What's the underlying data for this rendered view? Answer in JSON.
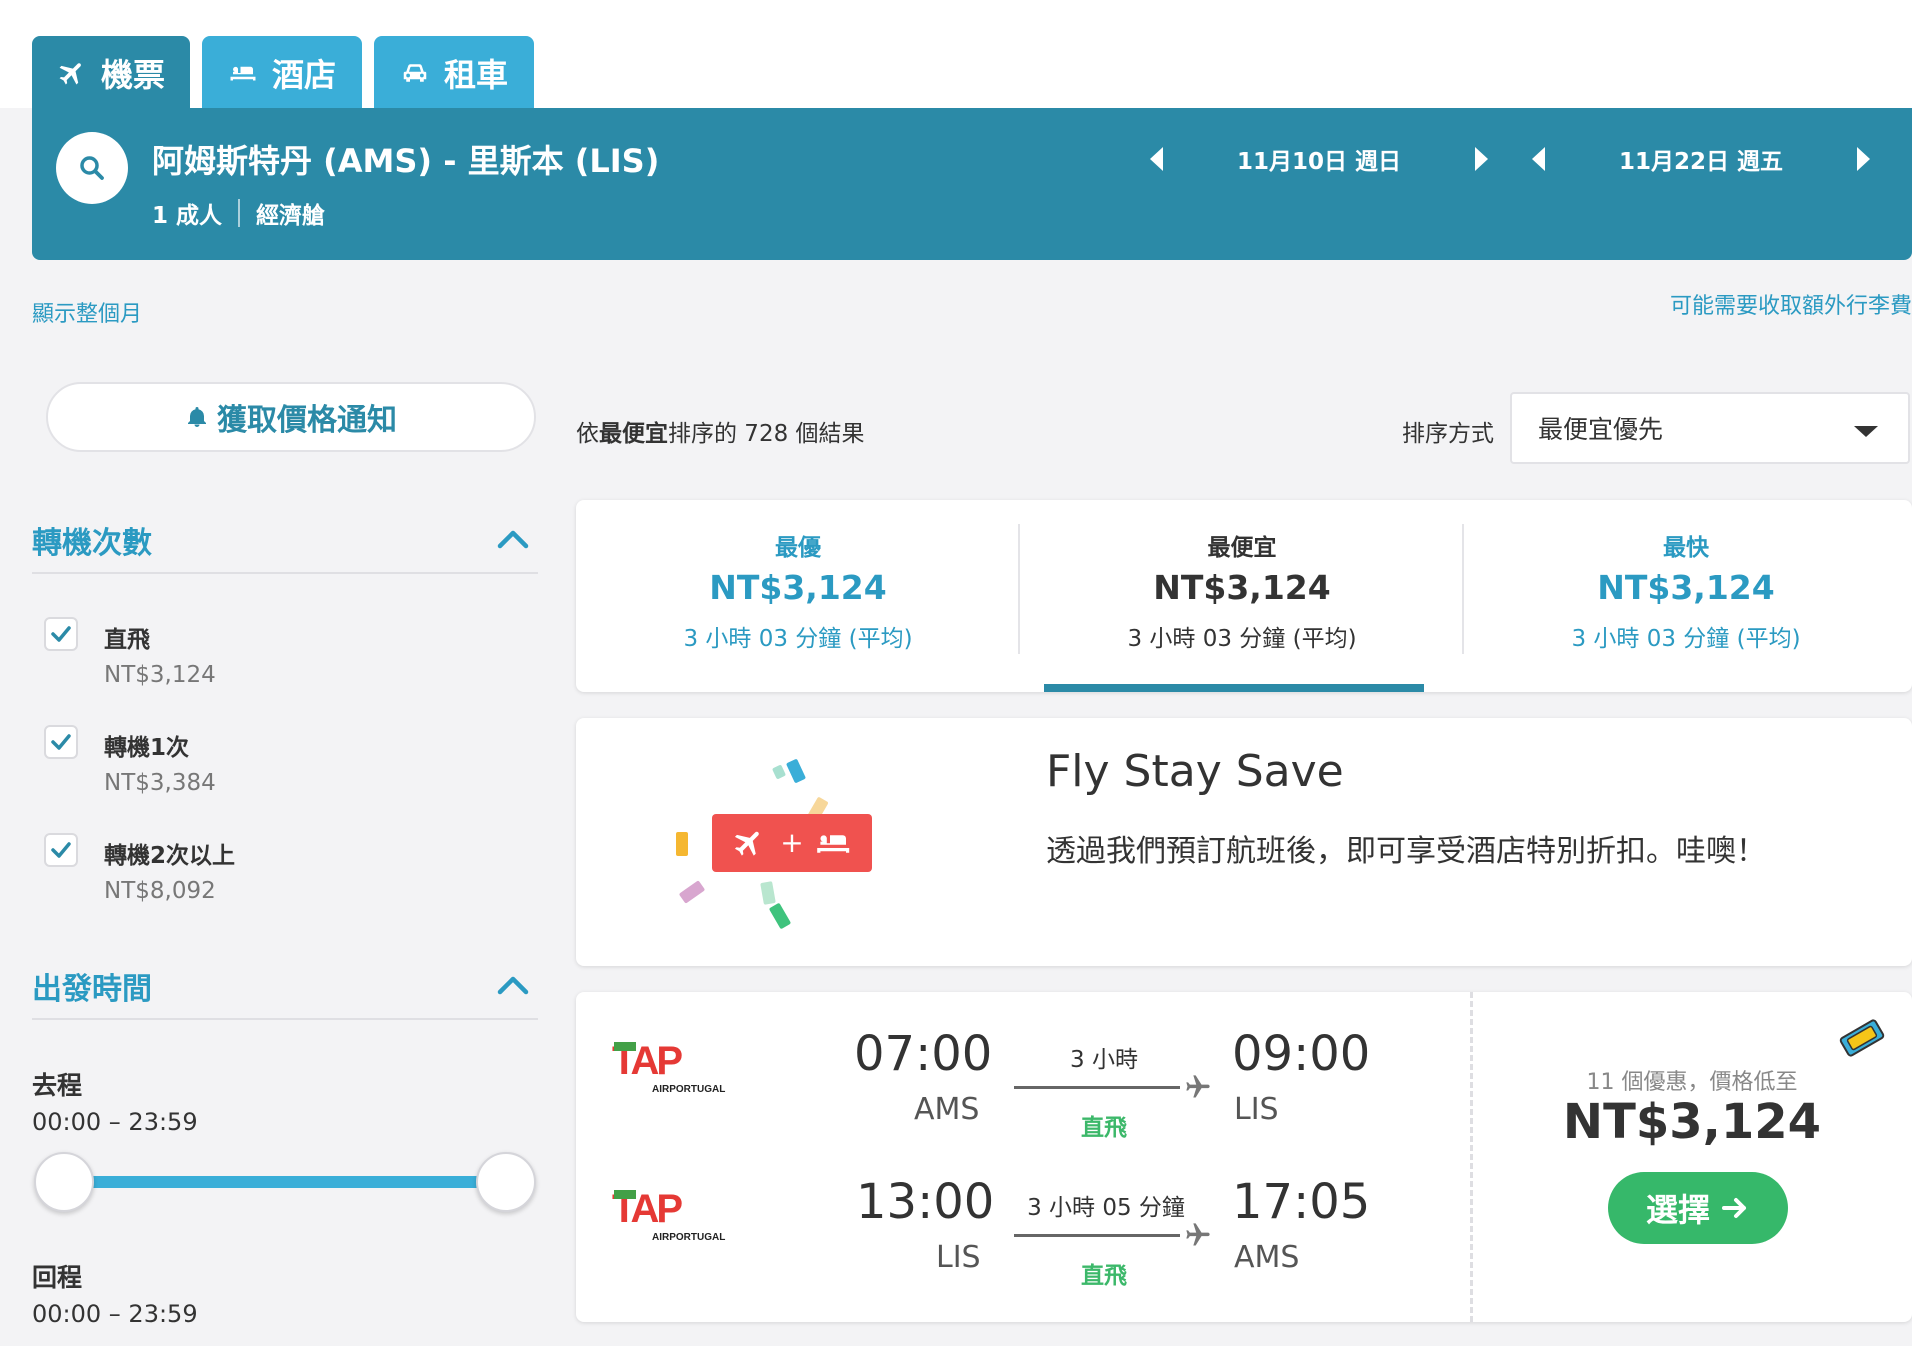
{
  "tabs": [
    {
      "label": "機票",
      "icon": "plane-icon"
    },
    {
      "label": "酒店",
      "icon": "bed-icon"
    },
    {
      "label": "租車",
      "icon": "car-icon"
    }
  ],
  "search": {
    "route": "阿姆斯特丹 (AMS) - 里斯本 (LIS)",
    "passengers": "1 成人",
    "cabin": "經濟艙",
    "depart_date": "11月10日 週日",
    "return_date": "11月22日 週五"
  },
  "links": {
    "show_month": "顯示整個月",
    "baggage_fee": "可能需要收取額外行李費"
  },
  "sidebar": {
    "price_alert": "獲取價格通知",
    "stops": {
      "title": "轉機次數",
      "options": [
        {
          "label": "直飛",
          "price": "NT$3,124",
          "checked": true
        },
        {
          "label": "轉機1次",
          "price": "NT$3,384",
          "checked": true
        },
        {
          "label": "轉機2次以上",
          "price": "NT$8,092",
          "checked": true
        }
      ]
    },
    "departure_time": {
      "title": "出發時間",
      "outbound_label": "去程",
      "outbound_range": "00:00 – 23:59",
      "return_label": "回程",
      "return_range": "00:00 – 23:59"
    }
  },
  "results": {
    "count_prefix": "依",
    "count_bold": "最便宜",
    "count_suffix": "排序的 728 個結果",
    "sort_label": "排序方式",
    "sort_value": "最便宜優先"
  },
  "summary": [
    {
      "label": "最優",
      "price": "NT$3,124",
      "duration": "3 小時 03 分鐘 (平均)",
      "active": false
    },
    {
      "label": "最便宜",
      "price": "NT$3,124",
      "duration": "3 小時 03 分鐘 (平均)",
      "active": true
    },
    {
      "label": "最快",
      "price": "NT$3,124",
      "duration": "3 小時 03 分鐘 (平均)",
      "active": false
    }
  ],
  "promo": {
    "title": "Fly Stay Save",
    "text": "透過我們預訂航班後，即可享受酒店特別折扣。哇噢！",
    "badge_plus": "+"
  },
  "flight": {
    "legs": [
      {
        "airline_logo": "TAP",
        "airline_sub": "AIRPORTUGAL",
        "dep_time": "07:00",
        "dep_airport": "AMS",
        "duration": "3 小時",
        "stops": "直飛",
        "arr_time": "09:00",
        "arr_airport": "LIS"
      },
      {
        "airline_logo": "TAP",
        "airline_sub": "AIRPORTUGAL",
        "dep_time": "13:00",
        "dep_airport": "LIS",
        "duration": "3 小時 05 分鐘",
        "stops": "直飛",
        "arr_time": "17:05",
        "arr_airport": "AMS"
      }
    ],
    "deals": "11 個優惠，價格低至",
    "price": "NT$3,124",
    "select_label": "選擇"
  },
  "colors": {
    "primary": "#2b8aa7",
    "accent": "#3aaed8",
    "link": "#2b9ac2",
    "green": "#36b86a",
    "promo_red": "#f0524f"
  }
}
